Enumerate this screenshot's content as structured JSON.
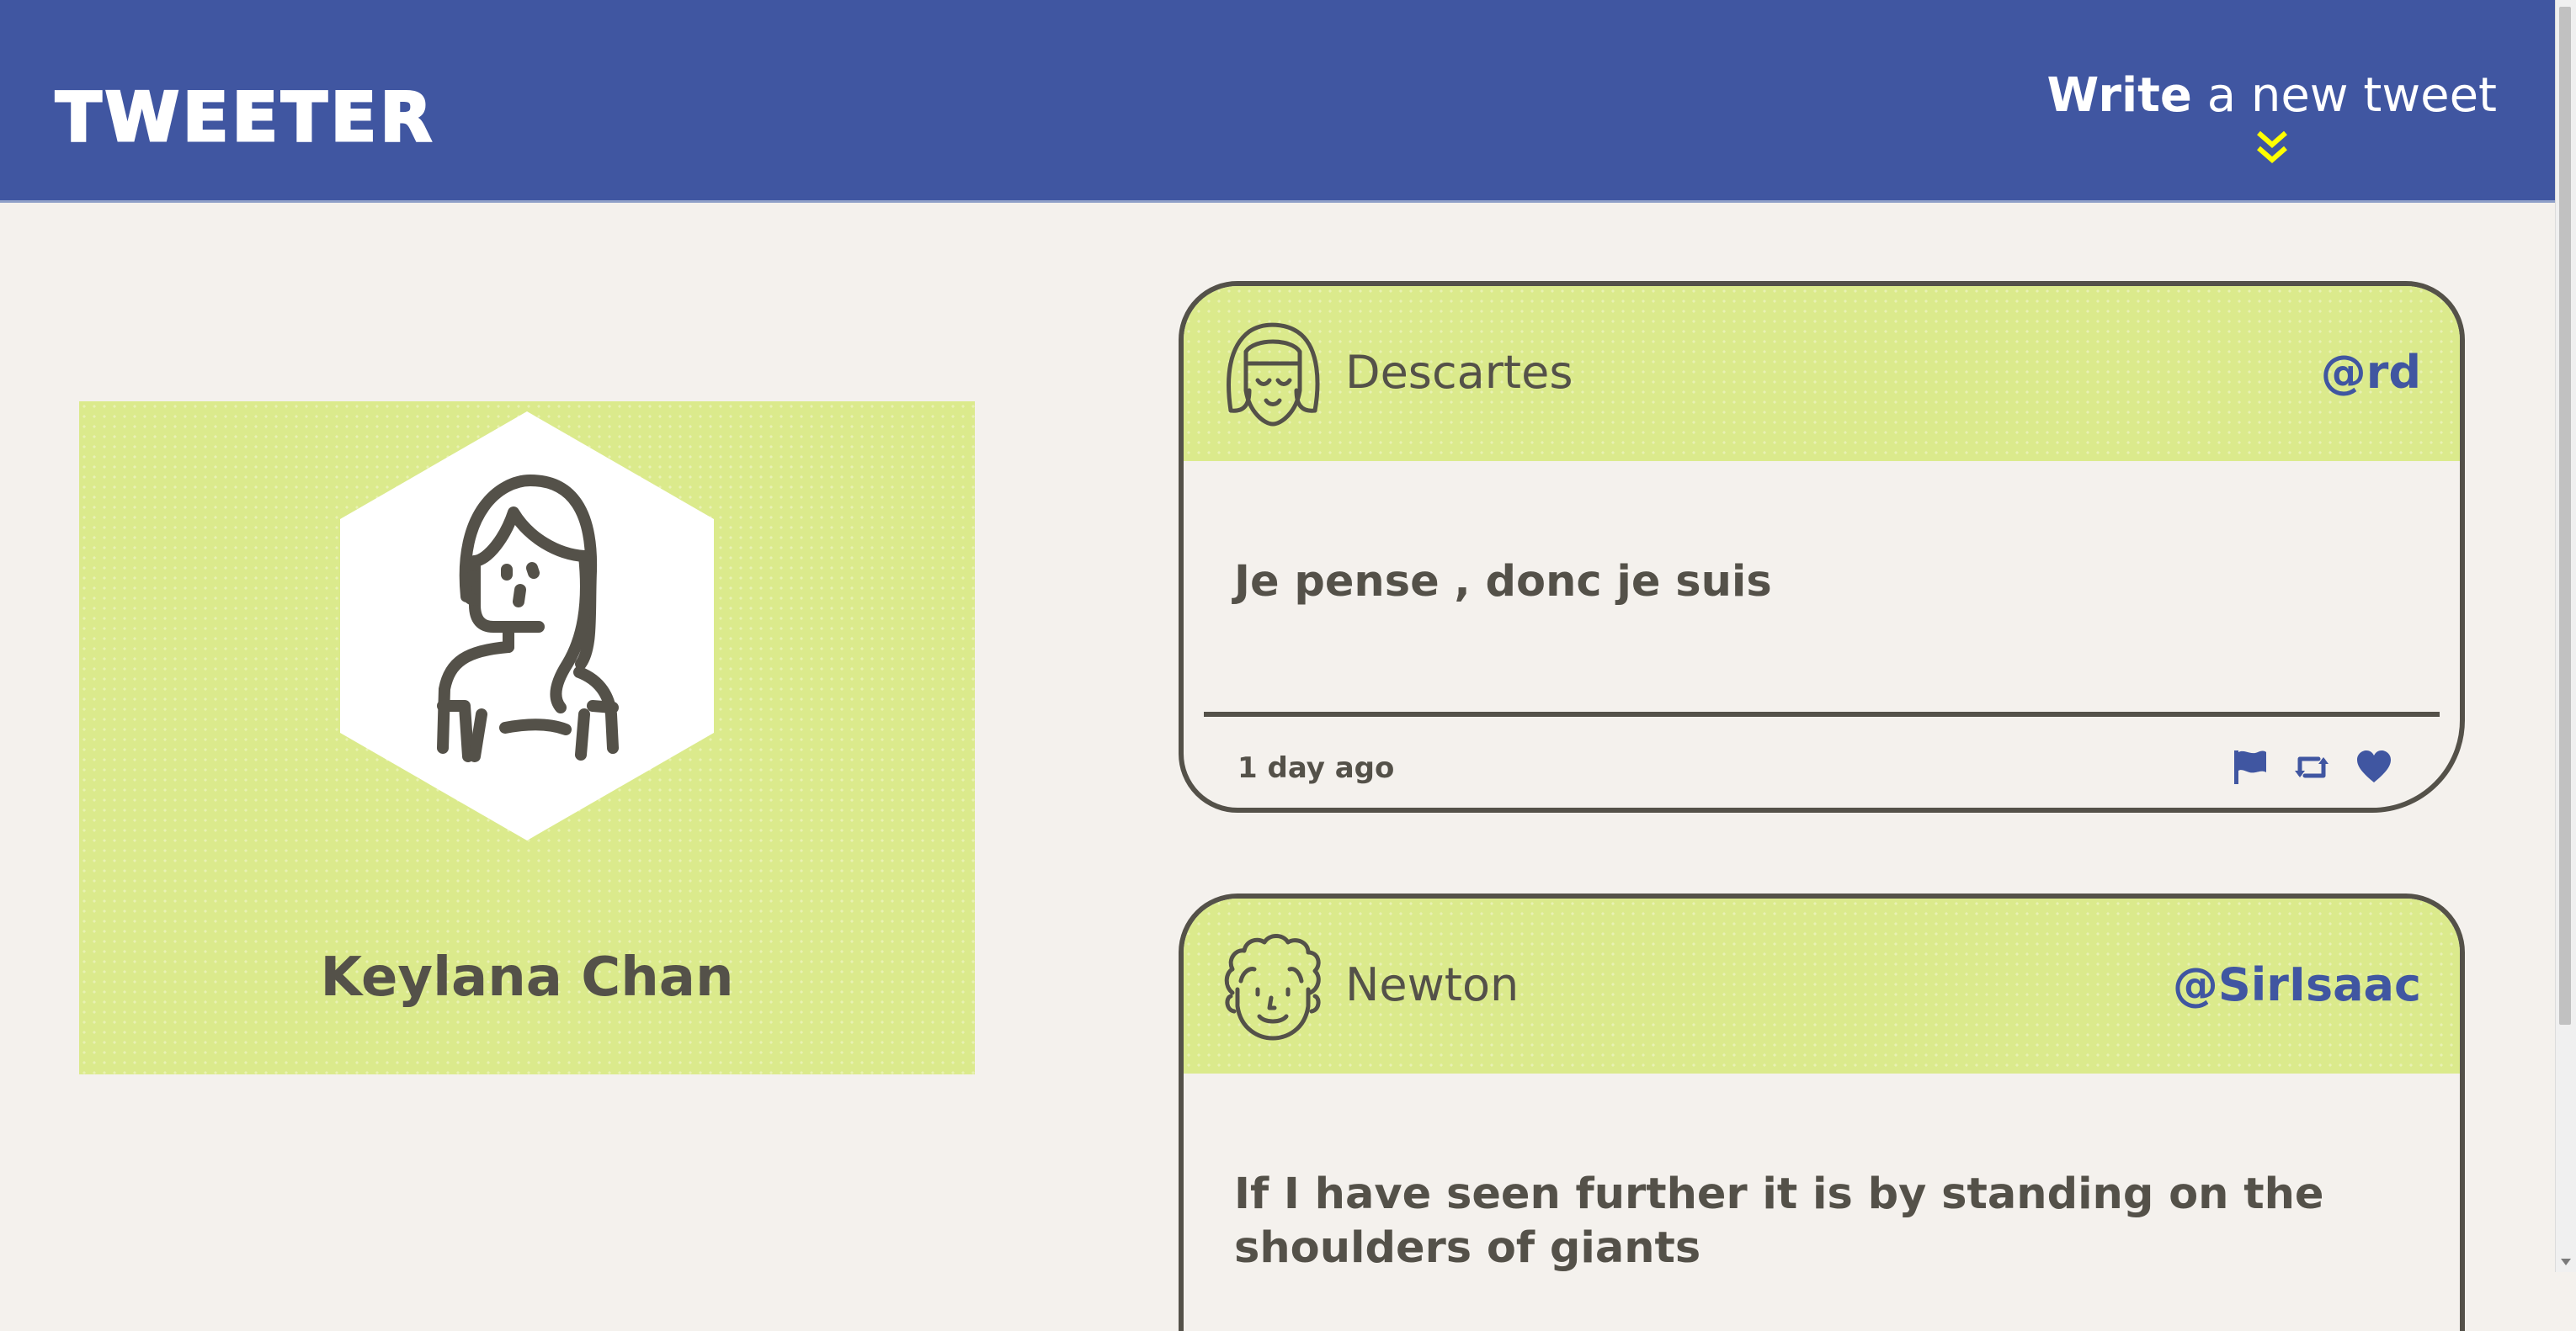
{
  "nav": {
    "brand": "TWEETER",
    "compose_strong": "Write",
    "compose_rest": " a new tweet",
    "compose_icon": "double-chevron-down-icon",
    "accent": "#4056a1",
    "chevron_color": "#ffff00"
  },
  "profile": {
    "name": "Keylana Chan",
    "avatar_icon": "girl-avatar-icon",
    "background": "#dbea8c"
  },
  "tweets": [
    {
      "name": "Descartes",
      "handle": "@rd",
      "text": "Je pense , donc je suis",
      "date": "1 day ago",
      "avatar_icon": "bob-hair-avatar-icon",
      "actions": [
        "flag-icon",
        "retweet-icon",
        "heart-icon"
      ]
    },
    {
      "name": "Newton",
      "handle": "@SirIsaac",
      "text": "If I have seen further it is by standing on the shoulders of giants",
      "avatar_icon": "curly-hair-avatar-icon"
    }
  ]
}
